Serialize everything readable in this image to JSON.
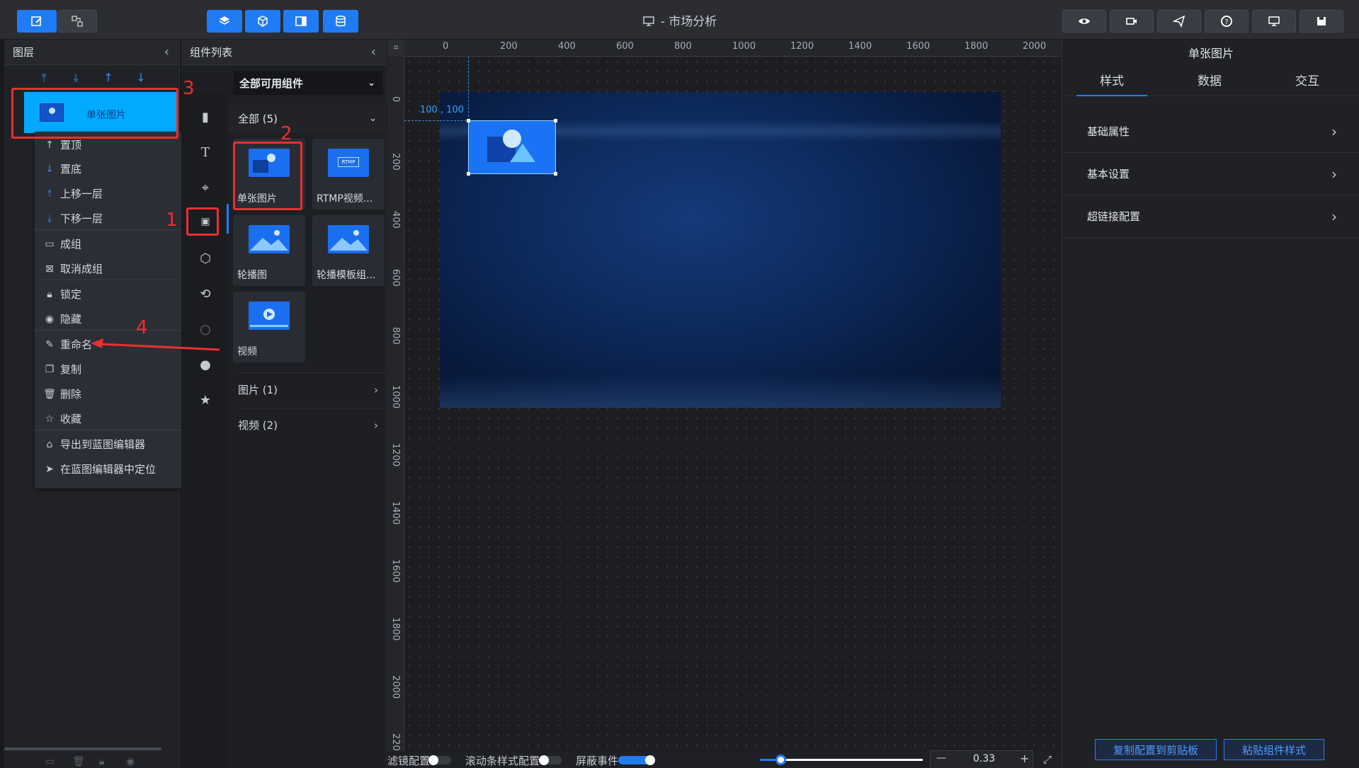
{
  "window": {
    "title": "- 市场分析"
  },
  "layers_panel": {
    "title": "图层",
    "selected_layer": "单张图片",
    "context_menu": [
      {
        "label": "置顶",
        "icon": "arrow-up-top-icon"
      },
      {
        "label": "置底",
        "icon": "arrow-down-bottom-icon"
      },
      {
        "label": "上移一层",
        "icon": "arrow-up-icon"
      },
      {
        "label": "下移一层",
        "icon": "arrow-down-icon"
      },
      {
        "label": "成组",
        "icon": "folder-icon"
      },
      {
        "label": "取消成组",
        "icon": "ungroup-icon"
      },
      {
        "label": "锁定",
        "icon": "lock-icon"
      },
      {
        "label": "隐藏",
        "icon": "eye-icon"
      },
      {
        "label": "重命名",
        "icon": "pencil-icon"
      },
      {
        "label": "复制",
        "icon": "copy-icon"
      },
      {
        "label": "删除",
        "icon": "trash-icon"
      },
      {
        "label": "收藏",
        "icon": "star-icon"
      },
      {
        "label": "导出到蓝图编辑器",
        "icon": "blueprint-icon"
      },
      {
        "label": "在蓝图编辑器中定位",
        "icon": "locate-icon"
      }
    ]
  },
  "component_panel": {
    "title": "组件列表",
    "filter_value": "全部可用组件",
    "section_all": "全部 (5)",
    "components": [
      "单张图片",
      "RTMP视频...",
      "轮播图",
      "轮播模板组...",
      "视频"
    ],
    "section_image": "图片 (1)",
    "section_video": "视频 (2)"
  },
  "canvas": {
    "ruler_x": [
      "0",
      "200",
      "400",
      "600",
      "800",
      "1000",
      "1200",
      "1400",
      "1600",
      "1800",
      "2000"
    ],
    "ruler_y": [
      "0",
      "200",
      "400",
      "600",
      "800",
      "1000",
      "1200",
      "1400",
      "1600",
      "1800",
      "2000",
      "220"
    ],
    "position_label": "100 , 100",
    "bottom_bar": {
      "filter_label": "滤镜配置",
      "scrollbar_label": "滚动条样式配置",
      "block_events_label": "屏蔽事件",
      "zoom_value": "0.33",
      "zoom_minus": "—",
      "zoom_plus": "+"
    }
  },
  "properties_panel": {
    "title": "单张图片",
    "tabs": [
      "样式",
      "数据",
      "交互"
    ],
    "active_tab": 0,
    "sections": [
      "基础属性",
      "基本设置",
      "超链接配置"
    ],
    "copy_button": "复制配置到剪贴板",
    "paste_button": "粘贴组件样式"
  },
  "annotations": {
    "n1": "1",
    "n2": "2",
    "n3": "3",
    "n4": "4"
  },
  "colors": {
    "accent": "#1f7cf5",
    "selection": "#00aaff",
    "annotation": "#ea2f2f"
  }
}
